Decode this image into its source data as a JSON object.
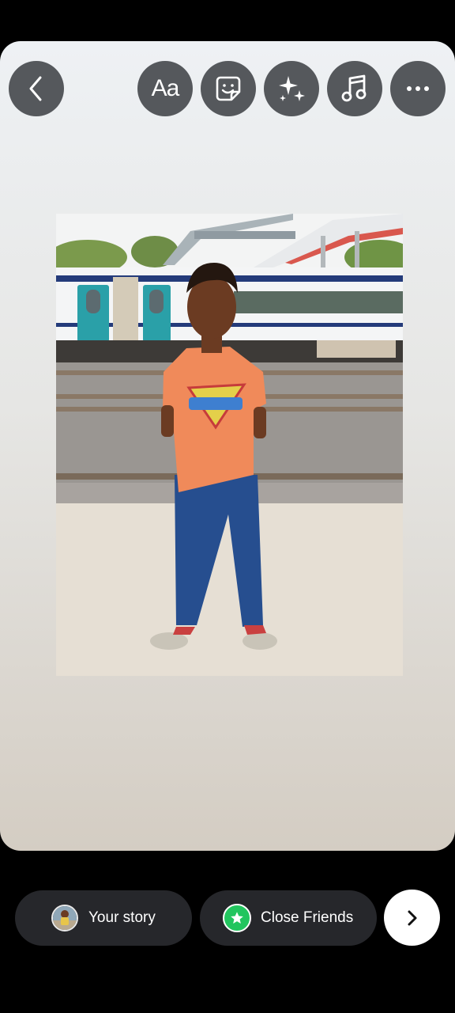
{
  "top_toolbar": {
    "back_icon": "chevron-left-icon",
    "text_tool_label": "Aa",
    "sticker_icon": "sticker-icon",
    "effects_icon": "sparkles-icon",
    "music_icon": "music-note-icon",
    "more_icon": "more-horizontal-icon"
  },
  "bottom_bar": {
    "your_story_label": "Your story",
    "close_friends_label": "Close Friends",
    "next_icon": "chevron-right-icon",
    "close_friends_color": "#22c55e"
  }
}
